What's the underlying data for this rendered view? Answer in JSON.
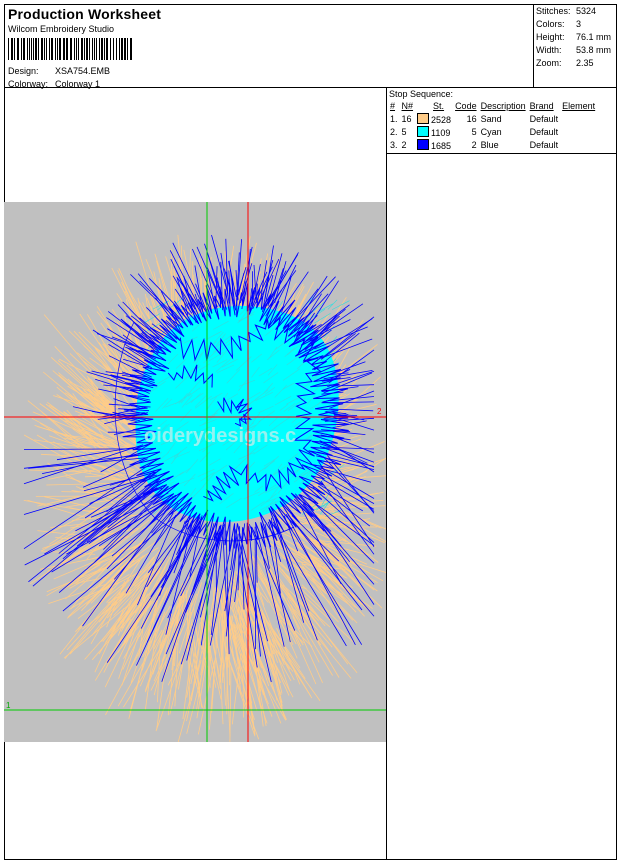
{
  "header": {
    "title": "Production Worksheet",
    "software": "Wilcom Embroidery Studio",
    "design_label": "Design:",
    "design_value": "XSA754.EMB",
    "colorway_label": "Colorway:",
    "colorway_value": "Colorway 1"
  },
  "stats": [
    {
      "label": "Stitches:",
      "value": "5324"
    },
    {
      "label": "Colors:",
      "value": "3"
    },
    {
      "label": "Height:",
      "value": "76.1 mm"
    },
    {
      "label": "Width:",
      "value": "53.8 mm"
    },
    {
      "label": "Zoom:",
      "value": "2.35"
    }
  ],
  "stop_sequence": {
    "title": "Stop Sequence:",
    "columns": [
      "#",
      "N#",
      "St.",
      "Code",
      "Description",
      "Brand",
      "Element"
    ],
    "rows": [
      {
        "index": "1.",
        "n": "16",
        "color": "#ffcc88",
        "stitches": "2528",
        "code": "16",
        "description": "Sand",
        "brand": "Default",
        "element": ""
      },
      {
        "index": "2.",
        "n": "5",
        "color": "#00ffff",
        "stitches": "1109",
        "code": "5",
        "description": "Cyan",
        "brand": "Default",
        "element": ""
      },
      {
        "index": "3.",
        "n": "2",
        "color": "#0000ff",
        "stitches": "1685",
        "code": "2",
        "description": "Blue",
        "brand": "Default",
        "element": ""
      }
    ]
  },
  "preview": {
    "background": "#c0c0c0",
    "axis_marker_right": "2",
    "axis_marker_bottom": "1",
    "watermark": "oiderydesigns.c"
  }
}
